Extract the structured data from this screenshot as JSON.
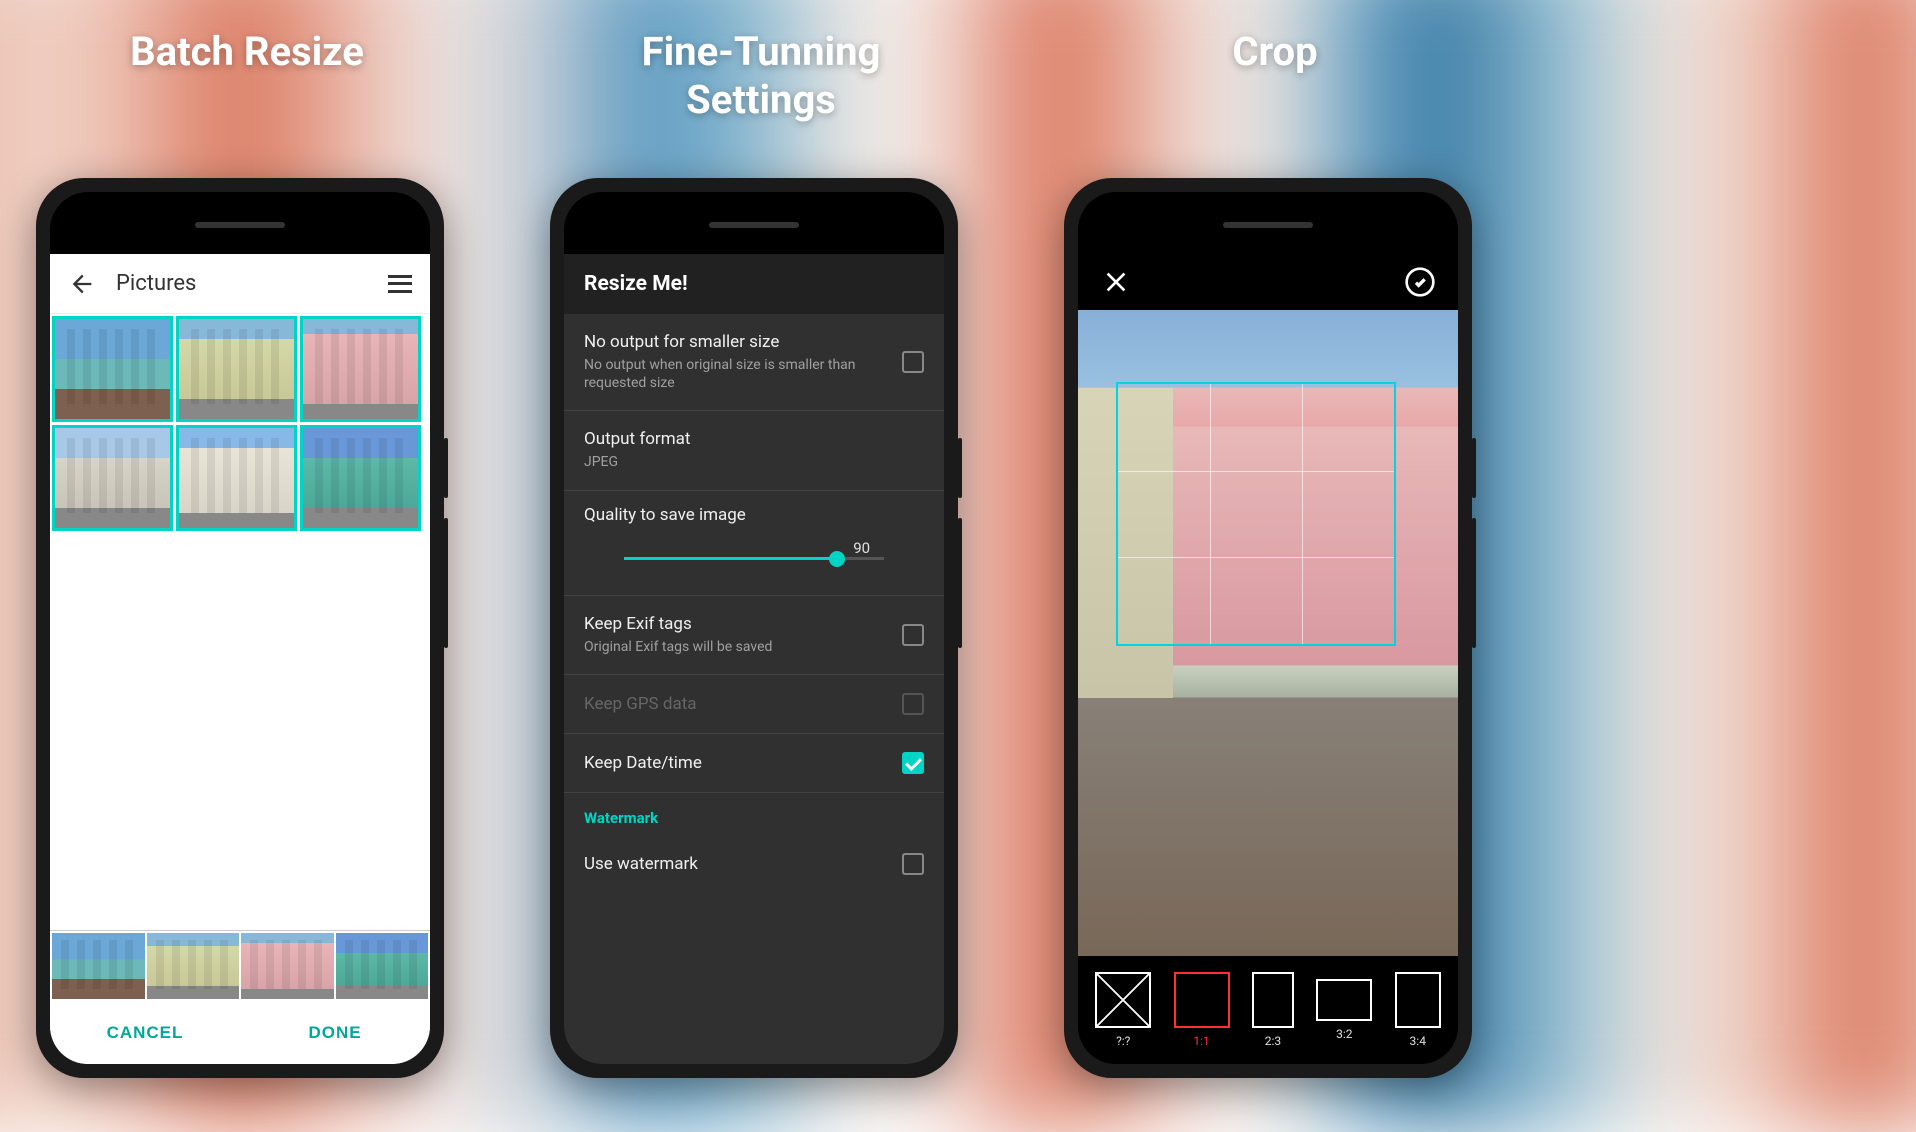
{
  "panels": {
    "batch": {
      "title": "Batch Resize"
    },
    "tuning": {
      "title": "Fine-Tunning\nSettings"
    },
    "crop": {
      "title": "Crop"
    }
  },
  "pictures": {
    "screenTitle": "Pictures",
    "cancel": "CANCEL",
    "done": "DONE"
  },
  "settings": {
    "appTitle": "Resize Me!",
    "noOutput": {
      "title": "No output for smaller size",
      "sub": "No output when original size is smaller than requested size",
      "checked": false
    },
    "outputFormat": {
      "title": "Output format",
      "value": "JPEG"
    },
    "quality": {
      "title": "Quality to save image",
      "value": 90,
      "min": 0,
      "max": 100
    },
    "keepExif": {
      "title": "Keep Exif tags",
      "sub": "Original Exif tags will be saved",
      "checked": false
    },
    "keepGps": {
      "title": "Keep GPS data",
      "checked": false,
      "disabled": true
    },
    "keepDate": {
      "title": "Keep Date/time",
      "checked": true
    },
    "watermarkSection": "Watermark",
    "useWatermark": {
      "title": "Use watermark",
      "checked": false
    }
  },
  "crop": {
    "ratios": [
      {
        "id": "free",
        "label": "?:?",
        "selected": false
      },
      {
        "id": "11",
        "label": "1:1",
        "selected": true
      },
      {
        "id": "23",
        "label": "2:3",
        "selected": false
      },
      {
        "id": "32",
        "label": "3:2",
        "selected": false
      },
      {
        "id": "34",
        "label": "3:4",
        "selected": false
      }
    ]
  }
}
